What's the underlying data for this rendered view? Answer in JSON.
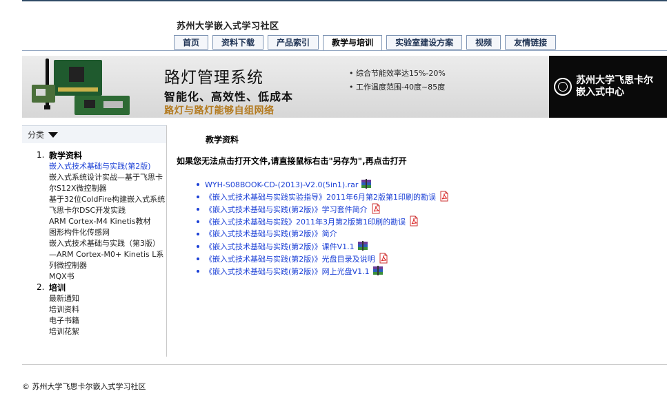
{
  "site": {
    "title": "苏州大学嵌入式学习社区"
  },
  "nav": {
    "tabs": [
      {
        "label": "首页",
        "active": false
      },
      {
        "label": "资料下载",
        "active": false
      },
      {
        "label": "产品索引",
        "active": false
      },
      {
        "label": "教学与培训",
        "active": true
      },
      {
        "label": "实验室建设方案",
        "active": false
      },
      {
        "label": "视频",
        "active": false
      },
      {
        "label": "友情链接",
        "active": false
      }
    ]
  },
  "banner": {
    "title": "路灯管理系统",
    "subtitle": "智能化、高效性、低成本",
    "subtitle2": "路灯与路灯能够自组网络",
    "features": [
      "综合节能效率达15%-20%",
      "工作温度范围-40度~85度"
    ],
    "logo_text": [
      "苏州大学飞思卡尔",
      "嵌入式中心"
    ]
  },
  "sidebar": {
    "header_label": "分类",
    "categories": [
      {
        "number": "1.",
        "title": "教学资料",
        "items": [
          {
            "label": "嵌入式技术基础与实践(第2版)",
            "current": true
          },
          {
            "label": "嵌入式系统设计实战—基于飞思卡尔S12X微控制器",
            "current": false
          },
          {
            "label": "基于32位ColdFire构建嵌入式系统",
            "current": false
          },
          {
            "label": "飞思卡尔DSC开发实践",
            "current": false
          },
          {
            "label": "ARM Cortex-M4 Kinetis教材",
            "current": false
          },
          {
            "label": "图形构件化传感网",
            "current": false
          },
          {
            "label": "嵌入式技术基础与实践（第3版）—ARM Cortex-M0+ Kinetis L系列微控制器",
            "current": false
          },
          {
            "label": "MQX书",
            "current": false
          }
        ]
      },
      {
        "number": "2.",
        "title": "培训",
        "items": [
          {
            "label": "最新通知",
            "current": false
          },
          {
            "label": "培训资料",
            "current": false
          },
          {
            "label": "电子书籍",
            "current": false
          },
          {
            "label": "培训花絮",
            "current": false
          }
        ]
      }
    ]
  },
  "content": {
    "section_title": "教学资料",
    "hint": "如果您无法点击打开文件,请直接鼠标右击\"另存为\",再点击打开",
    "documents": [
      {
        "label": "WYH-S08BOOK-CD-(2013)-V2.0(5in1).rar",
        "icon": "rar-archive-icon"
      },
      {
        "label": "《嵌入式技术基础与实践实验指导》2011年6月第2版第1印刷的勘误",
        "icon": "pdf-icon"
      },
      {
        "label": "《嵌入式技术基础与实践(第2版)》学习套件简介",
        "icon": "pdf-icon"
      },
      {
        "label": "《嵌入式技术基础与实践》2011年3月第2版第1印刷的勘误",
        "icon": "pdf-icon"
      },
      {
        "label": "《嵌入式技术基础与实践(第2版)》简介",
        "icon": ""
      },
      {
        "label": "《嵌入式技术基础与实践(第2版)》课件V1.1",
        "icon": "rar-archive-icon"
      },
      {
        "label": "《嵌入式技术基础与实践(第2版)》光盘目录及说明",
        "icon": "pdf-icon"
      },
      {
        "label": "《嵌入式技术基础与实践(第2版)》网上光盘V1.1",
        "icon": "rar-archive-icon"
      }
    ]
  },
  "footer": {
    "copyright": "© 苏州大学飞思卡尔嵌入式学习社区"
  },
  "colors": {
    "link": "#1a3fd6",
    "banner_accent": "#b37a1f",
    "nav_border": "#7f95b4"
  }
}
